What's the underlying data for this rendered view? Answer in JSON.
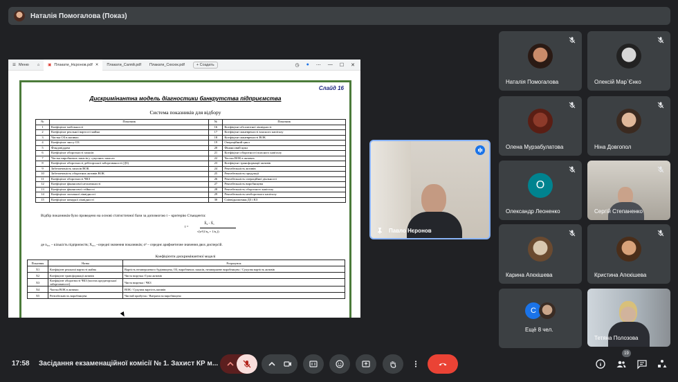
{
  "presenter_bar": {
    "title": "Наталія Помогалова (Показ)"
  },
  "browser": {
    "menu_label": "Меню",
    "tabs": [
      "Плакати_Нєронов.pdf",
      "Плакати_Саппй.pdf",
      "Плакати_Сюсюк.pdf"
    ],
    "new_tab_label": "+ Создать"
  },
  "slide": {
    "number": "Слайд 16",
    "title": "Дискримінантна модель діагностики банкрутства підприємства",
    "subtitle": "Система показників для відбору",
    "table1_headers": [
      "№",
      "Показник",
      "№",
      "Показник"
    ],
    "table1_rows": [
      [
        "1",
        "Коефіцієнт мобільності",
        "16",
        "Коефіцієнт абсолютної ліквідності"
      ],
      [
        "2",
        "Коефіцієнт реальної вартості майна",
        "17",
        "Коефіцієнт маневреності власного капіталу"
      ],
      [
        "3",
        "Частка ОЗ в активах",
        "18",
        "Коефіцієнт маневреності ВОК"
      ],
      [
        "4",
        "Коефіцієнт зносу ОЗ",
        "19",
        "Операційний цикл"
      ],
      [
        "5",
        "Фондовіддача",
        "20",
        "Фінансовий цикл"
      ],
      [
        "6",
        "Коефіцієнт оборотності запасів",
        "21",
        "Коефіцієнт оборотності власного капіталу"
      ],
      [
        "7",
        "Частка виробничих запасів у сукупних запасах",
        "22",
        "Частка ВОК в активах"
      ],
      [
        "8",
        "Коефіцієнт оборотності дебіторської заборгованості (ДЗ)",
        "23",
        "Коефіцієнт трансформації активів"
      ],
      [
        "9",
        "Забезпеченість запасів ВОК",
        "24",
        "Рентабельність активів"
      ],
      [
        "10",
        "Забезпеченість оборотних активів ВОК",
        "25",
        "Рентабельність продукції"
      ],
      [
        "11",
        "Коефіцієнт оборотності ЧКЗ",
        "26",
        "Рентабельність операційної діяльності"
      ],
      [
        "12",
        "Коефіцієнт фінансової незалежності",
        "27",
        "Рентабельність виробництва"
      ],
      [
        "13",
        "Коефіцієнт фінансової стійкості",
        "28",
        "Рентабельність оборотного капіталу"
      ],
      [
        "14",
        "Коефіцієнт загальної ліквідності",
        "29",
        "Рентабельність необоротного капіталу"
      ],
      [
        "15",
        "Коефіцієнт швидкої ліквідності",
        "30",
        "Співвідношення ДЗ і КЗ"
      ]
    ],
    "paragraph1": "Відбір показників було проведено на основі статистичної бази за допомогою t – критерію Стьюдента:",
    "formula_lhs": "t =",
    "formula_num": "X̄₀ - X̄₁",
    "formula_den": "√(σ²(1/n₀ + 1/n₁))",
    "paragraph2": "де n₀,₁ – кількість підприємств; X₀,₁ –середні значення показників; σ² – середнє арифметичне значення двох дисперсій.",
    "subtitle2": "Коефіцієнти дискримінантної моделі",
    "table2_headers": [
      "Показник",
      "Назва",
      "Розрахунок"
    ],
    "table2_rows": [
      [
        "X1",
        "Коефіцієнт реальної вартості майна",
        "Вартість незавершеного будівництва, ОЗ, виробничих запасів, незавершене виробництво / Сукупна вартість активів"
      ],
      [
        "X2",
        "Коефіцієнт трансформації активів",
        "Чиста виручка /Сума активів"
      ],
      [
        "X3",
        "Коефіцієнт оборотності ЧКЗ (чистих кредиторської заборгованості)",
        "Чиста виручка / ЧКЗ"
      ],
      [
        "X4",
        "Частка ВОК в активах",
        "ВОК / Сукупна вартість активів"
      ],
      [
        "X5",
        "Рентабельність виробництва",
        "Чистий прибуток / Витрати на виробництво"
      ]
    ]
  },
  "presenter_video": {
    "name": "Павло Нєронов"
  },
  "participants": [
    {
      "name": "Наталія Помогалова"
    },
    {
      "name": "Олексій Мар`Єнко"
    },
    {
      "name": "Олена Мурзабулатова"
    },
    {
      "name": "Ніна Довгопол"
    },
    {
      "name": "Олександр Леоненко",
      "letter": "О"
    },
    {
      "name": "Сергій Степаненко"
    },
    {
      "name": "Карина Апєкішева"
    },
    {
      "name": "Кристина Апєкішева"
    },
    {
      "name": "Ещё 8 чел.",
      "letter": "С"
    },
    {
      "name": "Тетяна Полозова"
    }
  ],
  "bottom_bar": {
    "time": "17:58",
    "meeting_title": "Засідання екзаменаційної комісії № 1. Захист КР м...",
    "participants_count": "19"
  },
  "colors": {
    "accent": "#8ab4f8",
    "end_call": "#ea4335",
    "mic_off": "#f28b82",
    "slide_border": "#4b7b3a"
  }
}
